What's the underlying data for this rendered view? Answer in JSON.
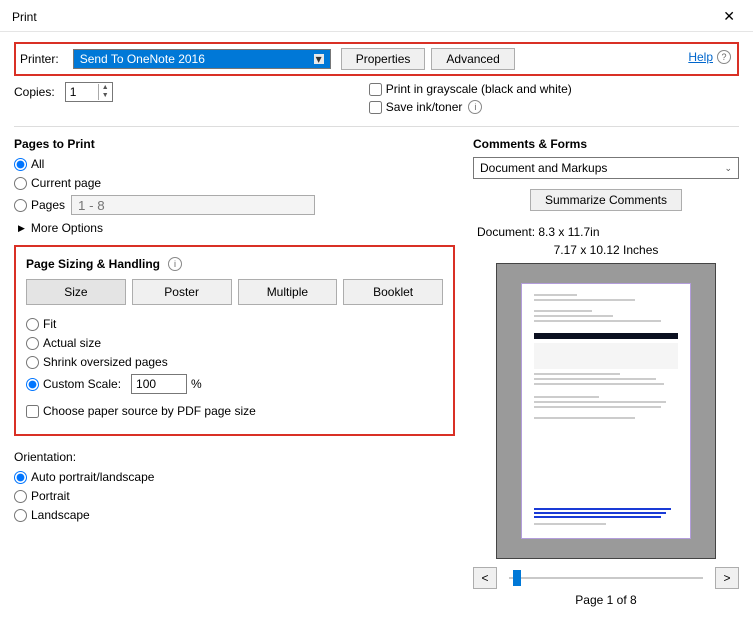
{
  "window": {
    "title": "Print"
  },
  "help_label": "Help",
  "printer": {
    "label": "Printer:",
    "selected": "Send To OneNote 2016",
    "properties_btn": "Properties",
    "advanced_btn": "Advanced"
  },
  "copies": {
    "label": "Copies:",
    "value": "1"
  },
  "options": {
    "grayscale_label": "Print in grayscale (black and white)",
    "saveink_label": "Save ink/toner"
  },
  "pages_to_print": {
    "title": "Pages to Print",
    "all": "All",
    "current": "Current page",
    "pages_label": "Pages",
    "pages_placeholder": "1 - 8",
    "more_options": "More Options"
  },
  "sizing": {
    "title": "Page Sizing & Handling",
    "tabs": {
      "size": "Size",
      "poster": "Poster",
      "multiple": "Multiple",
      "booklet": "Booklet"
    },
    "fit": "Fit",
    "actual": "Actual size",
    "shrink": "Shrink oversized pages",
    "custom": "Custom Scale:",
    "custom_value": "100",
    "percent": "%",
    "paper_source": "Choose paper source by PDF page size"
  },
  "orientation": {
    "title": "Orientation:",
    "auto": "Auto portrait/landscape",
    "portrait": "Portrait",
    "landscape": "Landscape"
  },
  "comments": {
    "title": "Comments & Forms",
    "selected": "Document and Markups",
    "summarize_btn": "Summarize Comments"
  },
  "preview": {
    "doc_dims": "Document: 8.3 x 11.7in",
    "inches": "7.17 x 10.12 Inches",
    "page_indicator": "Page 1 of 8",
    "prev": "<",
    "next": ">"
  }
}
